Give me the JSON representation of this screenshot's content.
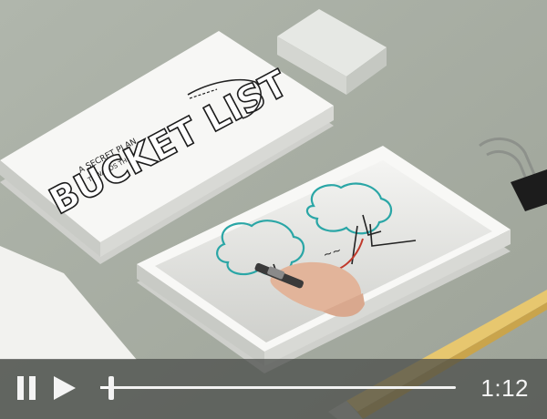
{
  "player": {
    "time_display": "1:12",
    "progress_fraction": 0.03
  },
  "scene": {
    "card_text_small": "A SECRET PLAN TOWARDS THE",
    "card_text_large": "BUCKET LIST"
  },
  "colors": {
    "background": "#a6aca1",
    "controls_bar": "#464a46",
    "tree_ink": "#2aa6a6",
    "accent_red": "#c0392b"
  },
  "icons": {
    "pause": "pause-icon",
    "play": "play-icon"
  }
}
